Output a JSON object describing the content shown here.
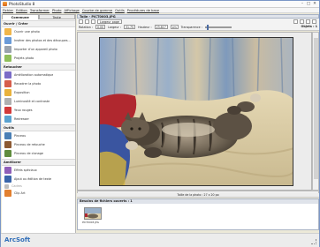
{
  "window": {
    "title": "PhotoStudio 8"
  },
  "menu": [
    "Fichier",
    "Edition",
    "Transformer",
    "Photo",
    "Affichage",
    "Courbe de gamme",
    "Outils",
    "Procédures de base"
  ],
  "left": {
    "tabs": [
      "Commune",
      "Texte"
    ],
    "sections": [
      {
        "title": "Ouvrir / Créer",
        "items": [
          {
            "label": "Ouvrir une photo",
            "icon": "folder-icon",
            "color": "#f0b64a"
          },
          {
            "label": "Insérer des photos et des découpes...",
            "icon": "picture-icon",
            "color": "#6a9bd8"
          },
          {
            "label": "Importer d'un appareil photo",
            "icon": "camera-icon",
            "color": "#9aa3ad"
          },
          {
            "label": "Projets photo",
            "icon": "projects-icon",
            "color": "#8fbf5a"
          }
        ]
      },
      {
        "title": "Retoucher",
        "items": [
          {
            "label": "Amélioration automatique",
            "icon": "magic-wand-icon",
            "color": "#7a6cc7"
          },
          {
            "label": "Recadrer la photo",
            "icon": "crop-icon",
            "color": "#d65d4b"
          },
          {
            "label": "Exposition",
            "icon": "exposure-icon",
            "color": "#e9b23c"
          },
          {
            "label": "Luminosité et contraste",
            "icon": "brightness-icon",
            "color": "#b0b0b0"
          },
          {
            "label": "Yeux rouges",
            "icon": "red-eye-icon",
            "color": "#d33a3a"
          },
          {
            "label": "Redresser",
            "icon": "straighten-icon",
            "color": "#5aa2d0"
          }
        ]
      },
      {
        "title": "Outils",
        "items": [
          {
            "label": "Pinceau",
            "icon": "brush-icon",
            "color": "#4a7fb5"
          },
          {
            "label": "Pinceau de retouche",
            "icon": "retouch-brush-icon",
            "color": "#8c5a33"
          },
          {
            "label": "Pinceau de clonage",
            "icon": "clone-brush-icon",
            "color": "#5f8c3e"
          }
        ]
      },
      {
        "title": "Améliorer",
        "items": [
          {
            "label": "Effets spéciaux",
            "icon": "effects-icon",
            "color": "#8f5fb8"
          },
          {
            "label": "Ajout ou édition de texte",
            "icon": "text-icon",
            "color": "#3a66aa"
          },
          {
            "label": "Cadres",
            "icon": "frame-icon",
            "color": "#bdbdbd",
            "small": true
          },
          {
            "label": "Clip Art",
            "icon": "clipart-icon",
            "color": "#e2802f"
          }
        ]
      }
    ]
  },
  "doc": {
    "title": "Toile - PICT0003.JPG"
  },
  "toolbar": {
    "zoom_value": "Largeur page",
    "rotation_label": "Rotation :",
    "rotation_value": "0.00",
    "width_label": "Largeur :",
    "width_value": "31.75",
    "height_label": "Hauteur :",
    "height_value": "23.817",
    "unit": "cm",
    "transparency_label": "Transparence :",
    "objects_label": "Objets : 1"
  },
  "photo_size": "Taille de la photo : 27 x 20 po",
  "files": {
    "header": "Besoins de fichiers ouverts : 1",
    "thumb_label": "PICT0003.JPG"
  },
  "status": {
    "logo": "ArcSoft"
  }
}
